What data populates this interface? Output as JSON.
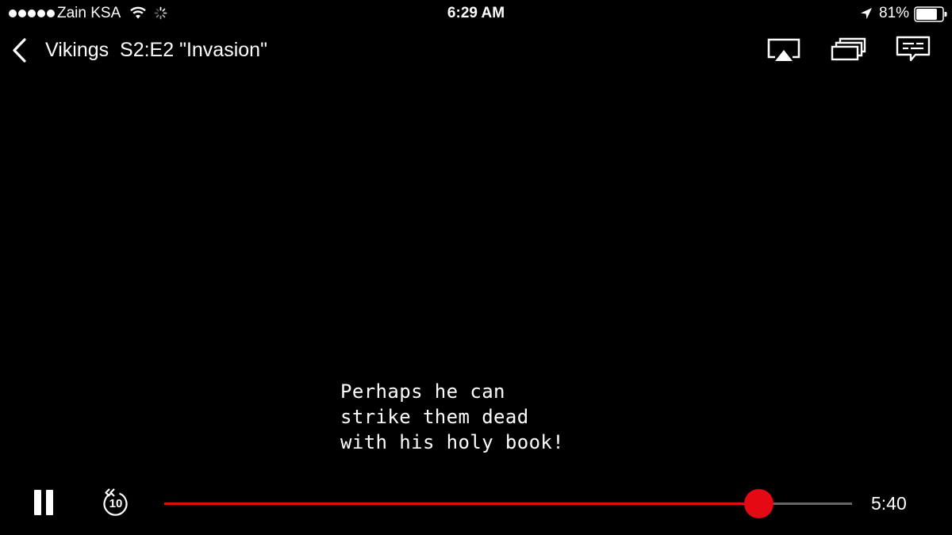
{
  "status_bar": {
    "carrier": "Zain KSA",
    "time": "6:29 AM",
    "battery": "81%",
    "battery_level": 0.81,
    "signal_bars": 5,
    "icons": [
      "signal-dots",
      "wifi-icon",
      "activity-spinner-icon",
      "location-arrow-icon",
      "battery-icon"
    ]
  },
  "header": {
    "title": "Vikings  S2:E2 \"Invasion\"",
    "icons": [
      "back-chevron-icon",
      "airplay-icon",
      "episodes-icon",
      "subtitles-icon"
    ]
  },
  "subtitle": {
    "text": "Perhaps he can\nstrike them dead\nwith his holy book!"
  },
  "controls": {
    "icons": [
      "pause-icon",
      "rewind-10-icon"
    ],
    "rewind_seconds": "10",
    "progress": 0.864,
    "time_remaining": "5:40"
  },
  "colors": {
    "accent": "#e50914",
    "track": "#666666",
    "background": "#000000",
    "foreground": "#ffffff"
  }
}
